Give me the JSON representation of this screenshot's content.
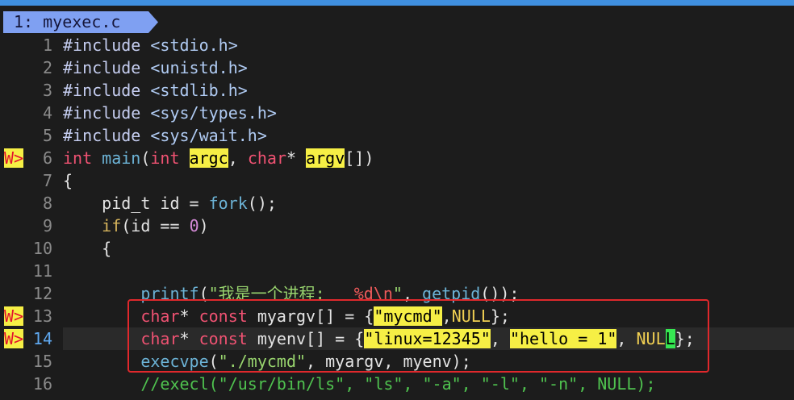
{
  "window": {
    "tab_label": "1: myexec.c"
  },
  "colors": {
    "background": "#1c1c1c",
    "top_strip": "#3f8fdf",
    "tab": "#7fa0f2",
    "tab_text": "#15163a",
    "line_nr": "#8a8a8a",
    "cursor_line_nr": "#5fa8ef",
    "cursor_line_bg": "#2a2a2a",
    "warning_sign_bg": "#f6ef45",
    "warning_sign_fg": "#e3122d",
    "annotation_box": "#e0282c"
  },
  "syntax_colors": {
    "normal": "#e4e4e4",
    "preproc": "#c5cdf0",
    "include": "#b0cbf3",
    "type": "#ef5272",
    "function": "#6cb3d6",
    "conditional": "#d6b45c",
    "number": "#d48ad6",
    "string": "#98d46e",
    "special": "#ef5a5a",
    "constant": "#f0cf52",
    "comment": "#4fc24f",
    "warn_bg": "#f6ef45",
    "warn_fg": "#000000",
    "cursor_bg": "#36e652",
    "cursor_fg": "#000000"
  },
  "editor": {
    "cursor_line": "14",
    "lines": [
      {
        "number": "1",
        "sign": "",
        "tokens": [
          {
            "text": "#include ",
            "hl": "preproc"
          },
          {
            "text": "<stdio.h>",
            "hl": "include"
          }
        ]
      },
      {
        "number": "2",
        "sign": "",
        "tokens": [
          {
            "text": "#include ",
            "hl": "preproc"
          },
          {
            "text": "<unistd.h>",
            "hl": "include"
          }
        ]
      },
      {
        "number": "3",
        "sign": "",
        "tokens": [
          {
            "text": "#include ",
            "hl": "preproc"
          },
          {
            "text": "<stdlib.h>",
            "hl": "include"
          }
        ]
      },
      {
        "number": "4",
        "sign": "",
        "tokens": [
          {
            "text": "#include ",
            "hl": "preproc"
          },
          {
            "text": "<sys/types.h>",
            "hl": "include"
          }
        ]
      },
      {
        "number": "5",
        "sign": "",
        "tokens": [
          {
            "text": "#include ",
            "hl": "preproc"
          },
          {
            "text": "<sys/wait.h>",
            "hl": "include"
          }
        ]
      },
      {
        "number": "6",
        "sign": "W>",
        "tokens": [
          {
            "text": "int",
            "hl": "type"
          },
          {
            "text": " ",
            "hl": "normal"
          },
          {
            "text": "main",
            "hl": "function"
          },
          {
            "text": "(",
            "hl": "normal"
          },
          {
            "text": "int",
            "hl": "type"
          },
          {
            "text": " ",
            "hl": "normal"
          },
          {
            "text": "argc",
            "hl": "warn"
          },
          {
            "text": ", ",
            "hl": "normal"
          },
          {
            "text": "char",
            "hl": "type"
          },
          {
            "text": "* ",
            "hl": "normal"
          },
          {
            "text": "argv",
            "hl": "warn"
          },
          {
            "text": "[])",
            "hl": "normal"
          }
        ]
      },
      {
        "number": "7",
        "sign": "",
        "tokens": [
          {
            "text": "{",
            "hl": "normal"
          }
        ]
      },
      {
        "number": "8",
        "sign": "",
        "tokens": [
          {
            "text": "    pid_t id = ",
            "hl": "normal"
          },
          {
            "text": "fork",
            "hl": "function"
          },
          {
            "text": "();",
            "hl": "normal"
          }
        ]
      },
      {
        "number": "9",
        "sign": "",
        "tokens": [
          {
            "text": "    ",
            "hl": "normal"
          },
          {
            "text": "if",
            "hl": "conditional"
          },
          {
            "text": "(id == ",
            "hl": "normal"
          },
          {
            "text": "0",
            "hl": "number"
          },
          {
            "text": ")",
            "hl": "normal"
          }
        ]
      },
      {
        "number": "10",
        "sign": "",
        "tokens": [
          {
            "text": "    {",
            "hl": "normal"
          }
        ]
      },
      {
        "number": "11",
        "sign": "",
        "tokens": []
      },
      {
        "number": "12",
        "sign": "",
        "tokens": [
          {
            "text": "        ",
            "hl": "normal"
          },
          {
            "text": "printf",
            "hl": "function"
          },
          {
            "text": "(",
            "hl": "normal"
          },
          {
            "text": "\"我是一个进程: ",
            "hl": "string"
          },
          {
            "text": "%d\\n",
            "hl": "special"
          },
          {
            "text": "\"",
            "hl": "string"
          },
          {
            "text": ", ",
            "hl": "normal"
          },
          {
            "text": "getpid",
            "hl": "function"
          },
          {
            "text": "());",
            "hl": "normal"
          }
        ]
      },
      {
        "number": "13",
        "sign": "W>",
        "tokens": [
          {
            "text": "        ",
            "hl": "normal"
          },
          {
            "text": "char",
            "hl": "type"
          },
          {
            "text": "* ",
            "hl": "normal"
          },
          {
            "text": "const",
            "hl": "type"
          },
          {
            "text": " myargv[] = {",
            "hl": "normal"
          },
          {
            "text": "\"mycmd\"",
            "hl": "warn"
          },
          {
            "text": ",",
            "hl": "normal"
          },
          {
            "text": "NULL",
            "hl": "constant"
          },
          {
            "text": "};",
            "hl": "normal"
          }
        ]
      },
      {
        "number": "14",
        "sign": "W>",
        "tokens": [
          {
            "text": "        ",
            "hl": "normal"
          },
          {
            "text": "char",
            "hl": "type"
          },
          {
            "text": "* ",
            "hl": "normal"
          },
          {
            "text": "const",
            "hl": "type"
          },
          {
            "text": " myenv[] = {",
            "hl": "normal"
          },
          {
            "text": "\"linux=12345\"",
            "hl": "warn"
          },
          {
            "text": ", ",
            "hl": "normal"
          },
          {
            "text": "\"hello = 1\"",
            "hl": "warn"
          },
          {
            "text": ", ",
            "hl": "normal"
          },
          {
            "text": "NUL",
            "hl": "constant"
          },
          {
            "text": "L",
            "hl": "cursor"
          },
          {
            "text": "};",
            "hl": "normal"
          }
        ]
      },
      {
        "number": "15",
        "sign": "",
        "tokens": [
          {
            "text": "        ",
            "hl": "normal"
          },
          {
            "text": "execvpe",
            "hl": "function"
          },
          {
            "text": "(",
            "hl": "normal"
          },
          {
            "text": "\"./mycmd\"",
            "hl": "string"
          },
          {
            "text": ", myargv, myenv);",
            "hl": "normal"
          }
        ]
      },
      {
        "number": "16",
        "sign": "",
        "tokens": [
          {
            "text": "        ",
            "hl": "normal"
          },
          {
            "text": "//execl(\"/usr/bin/ls\", \"ls\", \"-a\", \"-l\", \"-n\", NULL);",
            "hl": "comment"
          }
        ]
      }
    ]
  }
}
